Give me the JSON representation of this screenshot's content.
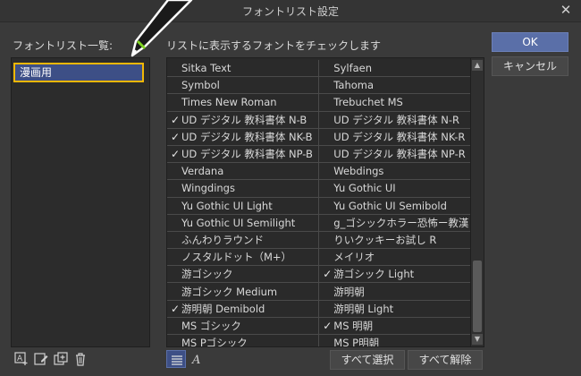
{
  "window": {
    "title": "フォントリスト設定",
    "close_glyph": "✕"
  },
  "left_panel": {
    "label": "フォントリスト一覧:",
    "items": [
      {
        "label": "漫画用",
        "selected": true
      }
    ]
  },
  "right_panel": {
    "label": "リストに表示するフォントをチェックします",
    "rows": [
      [
        {
          "name": "Sitka Text",
          "checked": false
        },
        {
          "name": "Sylfaen",
          "checked": false
        }
      ],
      [
        {
          "name": "Symbol",
          "checked": false
        },
        {
          "name": "Tahoma",
          "checked": false
        }
      ],
      [
        {
          "name": "Times New Roman",
          "checked": false
        },
        {
          "name": "Trebuchet MS",
          "checked": false
        }
      ],
      [
        {
          "name": "UD デジタル 教科書体 N-B",
          "checked": true
        },
        {
          "name": "UD デジタル 教科書体 N-R",
          "checked": false
        }
      ],
      [
        {
          "name": "UD デジタル 教科書体 NK-B",
          "checked": true
        },
        {
          "name": "UD デジタル 教科書体 NK-R",
          "checked": false
        }
      ],
      [
        {
          "name": "UD デジタル 教科書体 NP-B",
          "checked": true
        },
        {
          "name": "UD デジタル 教科書体 NP-R",
          "checked": false
        }
      ],
      [
        {
          "name": "Verdana",
          "checked": false
        },
        {
          "name": "Webdings",
          "checked": false
        }
      ],
      [
        {
          "name": "Wingdings",
          "checked": false
        },
        {
          "name": "Yu Gothic UI",
          "checked": false
        }
      ],
      [
        {
          "name": "Yu Gothic UI Light",
          "checked": false
        },
        {
          "name": "Yu Gothic UI Semibold",
          "checked": false
        }
      ],
      [
        {
          "name": "Yu Gothic UI Semilight",
          "checked": false
        },
        {
          "name": "g_ゴシックホラー恐怖ー教漢",
          "checked": false
        }
      ],
      [
        {
          "name": "ふんわりラウンド",
          "checked": false
        },
        {
          "name": "りいクッキーお試し R",
          "checked": false
        }
      ],
      [
        {
          "name": "ノスタルドット（M+）",
          "checked": false
        },
        {
          "name": "メイリオ",
          "checked": false
        }
      ],
      [
        {
          "name": "游ゴシック",
          "checked": false
        },
        {
          "name": "游ゴシック Light",
          "checked": true
        }
      ],
      [
        {
          "name": "游ゴシック Medium",
          "checked": false
        },
        {
          "name": "游明朝",
          "checked": false
        }
      ],
      [
        {
          "name": "游明朝 Demibold",
          "checked": true
        },
        {
          "name": "游明朝 Light",
          "checked": false
        }
      ],
      [
        {
          "name": "MS ゴシック",
          "checked": false
        },
        {
          "name": "MS 明朝",
          "checked": true
        }
      ],
      [
        {
          "name": "MS Pゴシック",
          "checked": false
        },
        {
          "name": "MS P明朝",
          "checked": false
        }
      ]
    ],
    "scroll_up_glyph": "▲",
    "scroll_down_glyph": "▼"
  },
  "buttons": {
    "ok": "OK",
    "cancel": "キャンセル",
    "select_all": "すべて選択",
    "deselect_all": "すべて解除"
  },
  "checkmark": "✓",
  "colors": {
    "accent": "#5a6fa8",
    "selection": "#3d4f86",
    "highlight_border": "#f2b705",
    "pen_ring": "#7ed321"
  }
}
